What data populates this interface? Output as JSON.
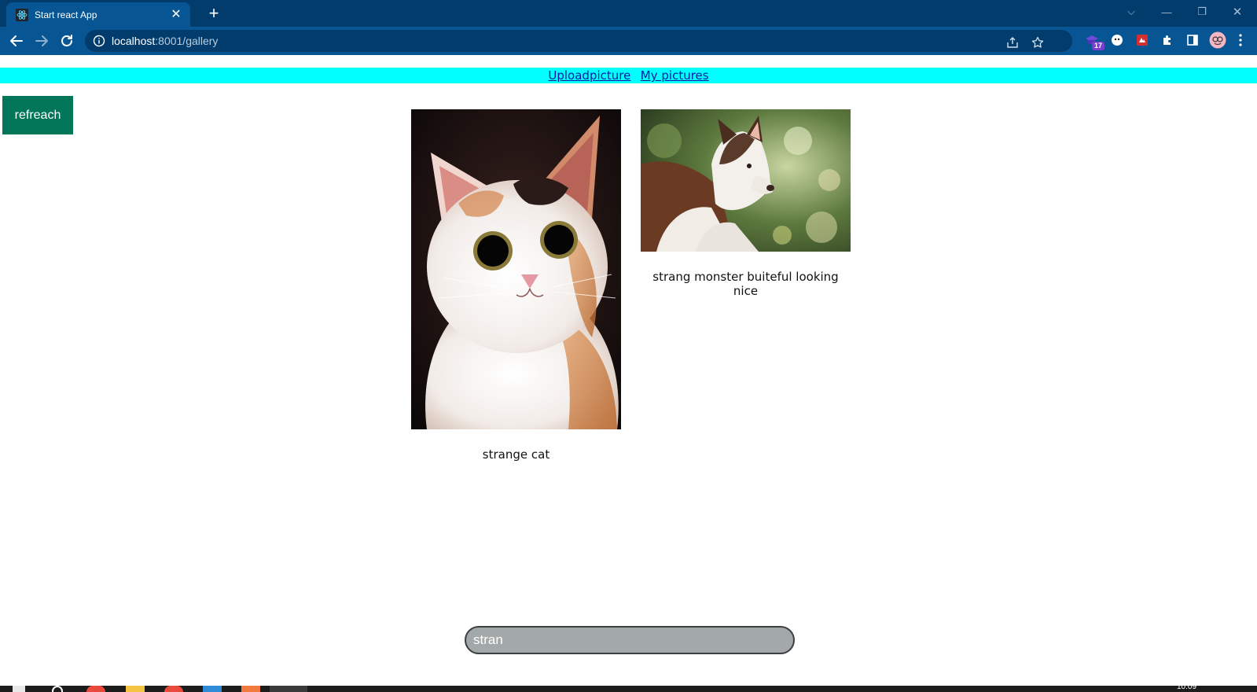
{
  "browser": {
    "tab_title": "Start react App",
    "tab_icon": "react-logo-icon",
    "url_host": "localhost",
    "url_path": ":8001/gallery",
    "extension_badge": "17"
  },
  "nav": {
    "upload_label": "Uploadpicture",
    "my_pictures_label": "My pictures"
  },
  "refresh_label": "refreach",
  "gallery": [
    {
      "image": "calico-kitten-photo",
      "caption": "strange cat"
    },
    {
      "image": "husky-dog-photo",
      "caption": "strang monster buiteful looking nice"
    }
  ],
  "search": {
    "value": "stran"
  },
  "colors": {
    "nav_bar": "#00ffff",
    "refresh_button": "#027659",
    "search_bg": "#a3a8a8",
    "chrome_dark": "#023c6c",
    "chrome_mid": "#075592"
  }
}
